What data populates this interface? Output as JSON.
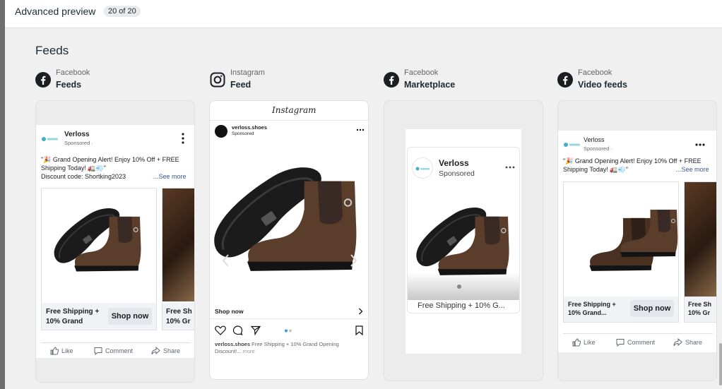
{
  "header": {
    "title": "Advanced preview",
    "badge": "20 of 20"
  },
  "section": {
    "title": "Feeds"
  },
  "placements": [
    {
      "platform": "Facebook",
      "name": "Feeds",
      "icon": "facebook-icon"
    },
    {
      "platform": "Instagram",
      "name": "Feed",
      "icon": "instagram-icon"
    },
    {
      "platform": "Facebook",
      "name": "Marketplace",
      "icon": "facebook-icon"
    },
    {
      "platform": "Facebook",
      "name": "Video feeds",
      "icon": "facebook-icon"
    }
  ],
  "fb_feed": {
    "page_name": "Verloss",
    "sponsored": "Sponsored · ",
    "primary_text_1": "\"🎉 Grand Opening Alert! Enjoy 10% Off + FREE",
    "primary_text_2": "Shipping Today! 🚛💨\"",
    "primary_text_3": "Discount code: Shortking2023",
    "see_more": "...See more",
    "card1_headline": "Free Shipping + 10% Grand",
    "card1_cta": "Shop now",
    "card2_headline": "Free Sh 10% Gr",
    "like": "Like",
    "comment": "Comment",
    "share": "Share"
  },
  "ig_feed": {
    "logo": "Instagram",
    "handle": "verloss.shoes",
    "sponsored": "Sponsored",
    "cta": "Shop now",
    "caption_handle": "verloss.shoes",
    "caption_text": "Free Shipping + 10% Grand Opening",
    "caption_text_2": "Discount!...",
    "more": "more"
  },
  "marketplace": {
    "page_name": "Verloss",
    "sponsored": "Sponsored",
    "headline": "Free Shipping + 10% G..."
  },
  "video_feed": {
    "page_name": "Verloss",
    "sponsored": "Sponsored · ",
    "primary_text_1": "\"🎉 Grand Opening Alert! Enjoy 10% Off + FREE",
    "primary_text_2": "Shipping Today! 🚛💨\"",
    "see_more": "...See more",
    "card1_headline": "Free Shipping + 10% Grand...",
    "card1_cta": "Shop now",
    "card2_headline": "Free Sh 10% Gr",
    "like": "Like",
    "comment": "Comment",
    "share": "Share"
  },
  "colors": {
    "accent": "#1877f2",
    "boot": "#5a3d2b",
    "sole": "#1b1b1b"
  }
}
